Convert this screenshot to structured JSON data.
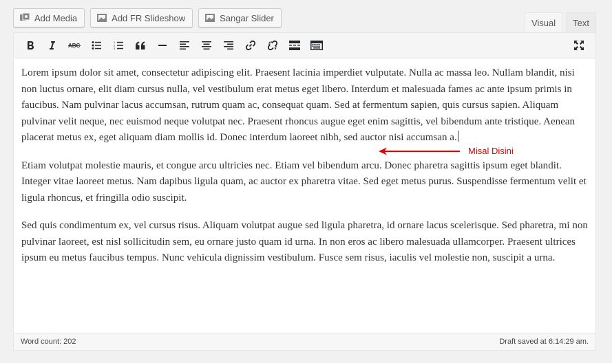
{
  "media_buttons": [
    {
      "label": "Add Media",
      "icon": "add-media-icon"
    },
    {
      "label": "Add FR Slideshow",
      "icon": "slideshow-icon"
    },
    {
      "label": "Sangar Slider",
      "icon": "slider-icon"
    }
  ],
  "tabs": {
    "visual": "Visual",
    "text": "Text"
  },
  "toolbar": [
    "bold-icon",
    "italic-icon",
    "strikethrough-icon",
    "bullet-list-icon",
    "numbered-list-icon",
    "blockquote-icon",
    "horizontal-line-icon",
    "align-left-icon",
    "align-center-icon",
    "align-right-icon",
    "insert-link-icon",
    "remove-link-icon",
    "read-more-icon",
    "toolbar-toggle-icon",
    "fullscreen-icon"
  ],
  "content": {
    "paragraphs": [
      "Lorem ipsum dolor sit amet, consectetur adipiscing elit. Praesent lacinia imperdiet vulputate. Nulla ac massa leo. Nullam blandit, nisi non luctus ornare, elit diam cursus nulla, vel vestibulum erat metus eget libero. Interdum et malesuada fames ac ante ipsum primis in faucibus. Nam pulvinar lacus accumsan, rutrum quam ac, consequat quam. Sed at fermentum sapien, quis cursus sapien. Aliquam pulvinar velit neque, nec euismod neque volutpat nec. Praesent rhoncus augue eget enim sagittis, vel bibendum ante tristique. Aenean placerat metus ex, eget aliquam diam mollis id. Donec interdum laoreet nibh, sed auctor nisi accumsan a.",
      "Etiam volutpat molestie mauris, et congue arcu ultricies nec. Etiam vel bibendum arcu. Donec pharetra sagittis ipsum eget blandit. Integer vitae laoreet metus. Nam dapibus ligula quam, ac auctor ex pharetra vitae. Sed eget metus purus. Suspendisse fermentum velit et ligula rhoncus, et fringilla odio suscipit.",
      "Sed quis condimentum ex, vel cursus risus. Aliquam volutpat augue sed ligula pharetra, id ornare lacus scelerisque. Sed pharetra, mi non pulvinar laoreet, est nisl sollicitudin sem, eu ornare justo quam id urna. In non eros ac libero malesuada ullamcorper. Praesent ultrices ipsum eu metus faucibus tempus. Nunc vehicula dignissim vestibulum. Fusce sem risus, iaculis vel molestie non, suscipit a urna."
    ]
  },
  "annotation": {
    "label": "Misal Disini",
    "color": "#e00000"
  },
  "status": {
    "word_count": "Word count: 202",
    "draft_saved": "Draft saved at 6:14:29 am."
  }
}
